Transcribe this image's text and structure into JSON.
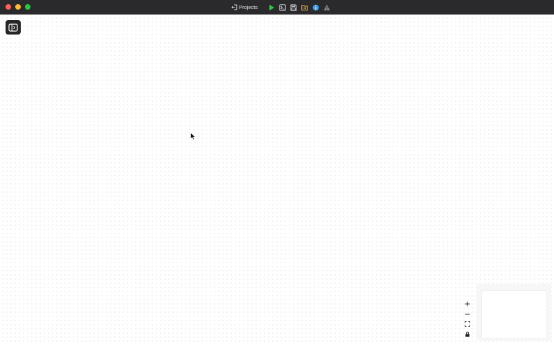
{
  "titlebar": {
    "projects_label": "Projects",
    "icons": [
      "projects-back-icon",
      "play-icon",
      "terminal-icon",
      "save-icon",
      "folder-icon",
      "info-icon",
      "warning-icon"
    ],
    "colors": {
      "play": "#2bc840",
      "folder": "#f5b933",
      "info": "#3d9bf0",
      "warning": "#8a8a8a"
    }
  },
  "sidebar_toggle": {
    "icon": "sidebar-toggle-icon"
  },
  "zoom_controls": {
    "icons": [
      "plus-icon",
      "minus-icon",
      "fit-view-icon",
      "lock-icon"
    ]
  },
  "minimap": {
    "label": ""
  }
}
